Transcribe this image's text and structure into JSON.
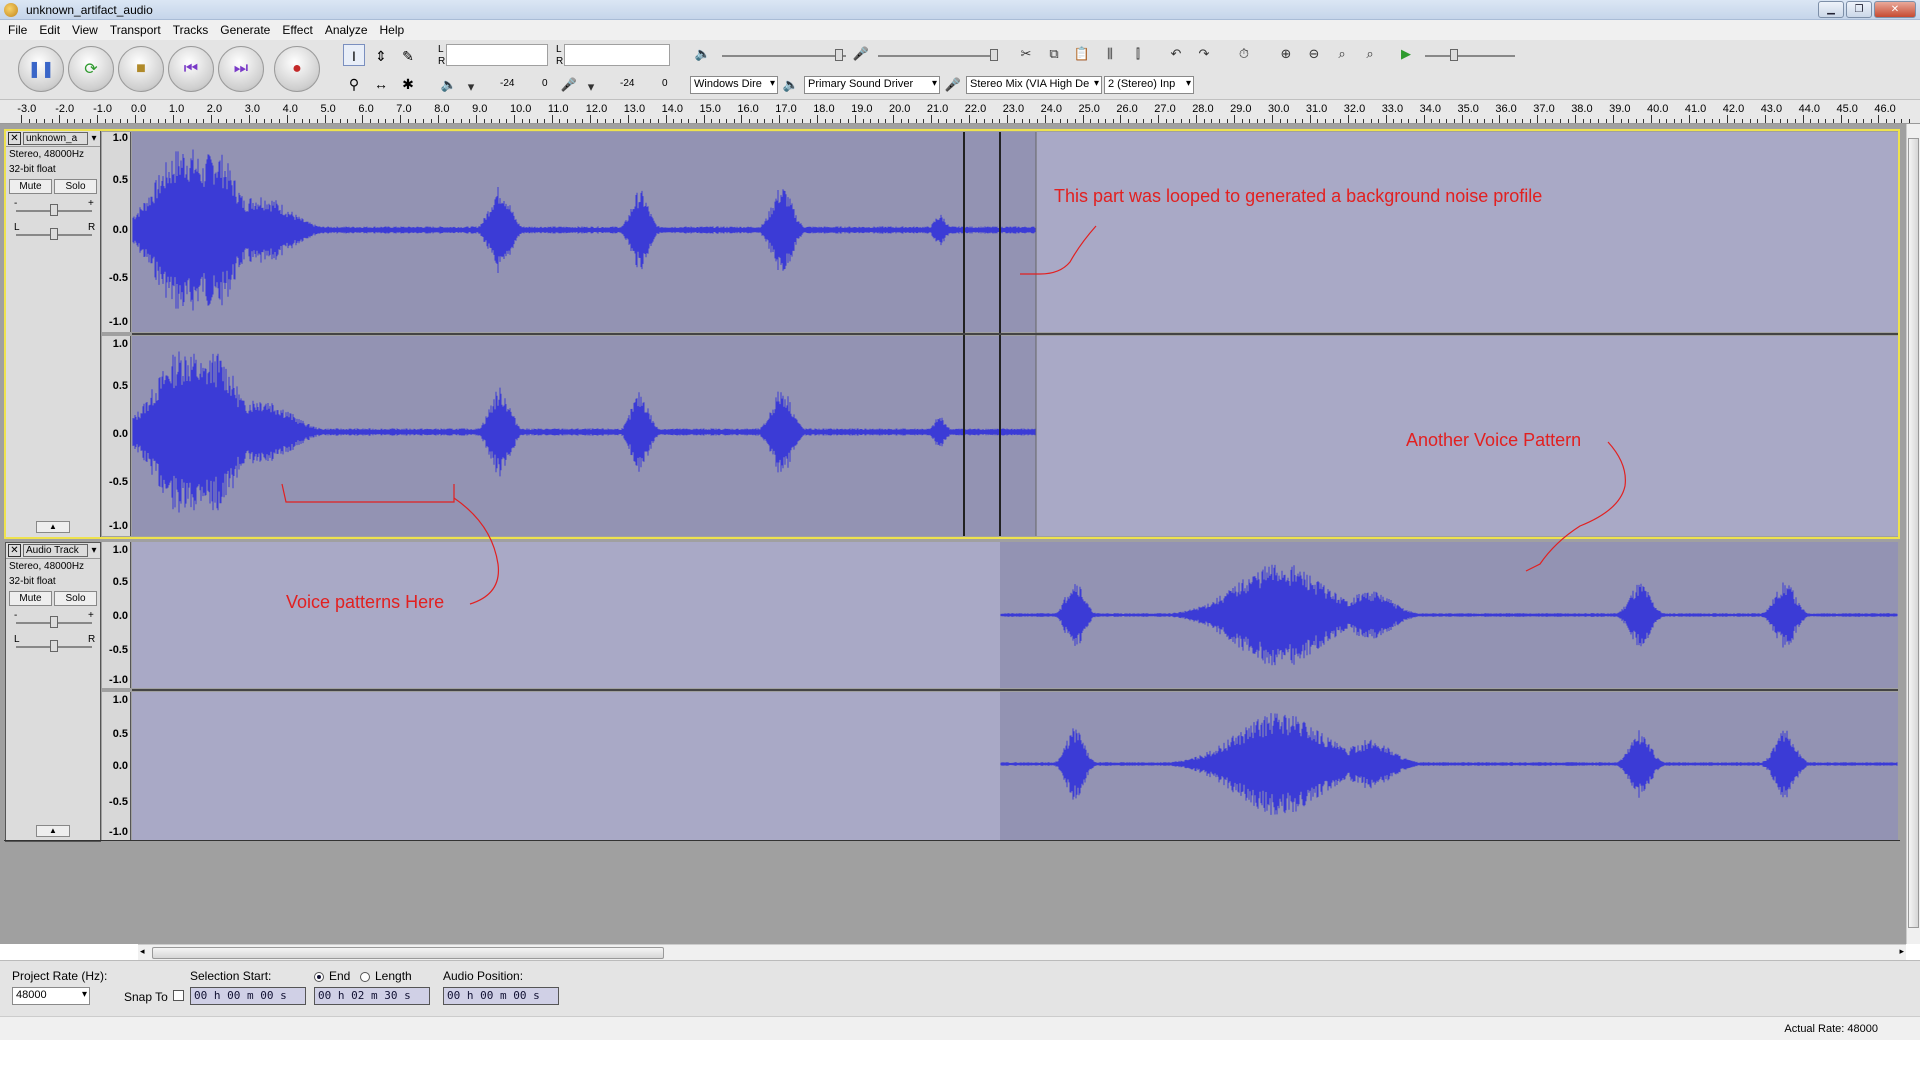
{
  "window": {
    "title": "unknown_artifact_audio"
  },
  "menu": [
    "File",
    "Edit",
    "View",
    "Transport",
    "Tracks",
    "Generate",
    "Effect",
    "Analyze",
    "Help"
  ],
  "meters": {
    "play_L": "L",
    "play_R": "R",
    "rec_L": "L",
    "rec_R": "R",
    "db_left": "-24",
    "db_zero": "0",
    "db_right": "-24",
    "db_zero2": "0"
  },
  "device": {
    "host": "Windows Dire",
    "output": "Primary Sound Driver",
    "input": "Stereo Mix (VIA High De",
    "channels": "2 (Stereo) Inp"
  },
  "ruler": {
    "labels": [
      "-3.0",
      "-2.0",
      "-1.0",
      "0.0",
      "1.0",
      "2.0",
      "3.0",
      "4.0",
      "5.0",
      "6.0",
      "7.0",
      "8.0",
      "9.0",
      "10.0",
      "11.0",
      "12.0",
      "13.0",
      "14.0",
      "15.0",
      "16.0",
      "17.0",
      "18.0",
      "19.0",
      "20.0",
      "21.0",
      "22.0",
      "23.0",
      "24.0",
      "25.0",
      "26.0",
      "27.0",
      "28.0",
      "29.0",
      "30.0",
      "31.0",
      "32.0",
      "33.0",
      "34.0",
      "35.0",
      "36.0",
      "37.0",
      "38.0",
      "39.0",
      "40.0",
      "41.0",
      "42.0",
      "43.0",
      "44.0",
      "45.0",
      "46.0"
    ]
  },
  "tracks": [
    {
      "name": "unknown_a",
      "format": "Stereo, 48000Hz",
      "depth": "32-bit float",
      "mute": "Mute",
      "solo": "Solo",
      "pan_l": "L",
      "pan_r": "R",
      "gain_minus": "-",
      "gain_plus": "+"
    },
    {
      "name": "Audio Track",
      "format": "Stereo, 48000Hz",
      "depth": "32-bit float",
      "mute": "Mute",
      "solo": "Solo",
      "pan_l": "L",
      "pan_r": "R",
      "gain_minus": "-",
      "gain_plus": "+"
    }
  ],
  "vscale": [
    "1.0",
    "0.5",
    "0.0",
    "-0.5",
    "-1.0"
  ],
  "annotations": {
    "noise": "This part was looped to generated a background noise profile",
    "voice": "Voice patterns Here",
    "another": "Another Voice Pattern"
  },
  "selection_bar": {
    "rate_label": "Project Rate (Hz):",
    "rate_value": "48000",
    "snap_label": "Snap To",
    "start_label": "Selection Start:",
    "end_label": "End",
    "length_label": "Length",
    "position_label": "Audio Position:",
    "start_value": "00 h 00 m 00 s",
    "end_value": "00 h 02 m 30 s",
    "position_value": "00 h 00 m 00 s"
  },
  "status": {
    "actual_rate": "Actual Rate: 48000"
  },
  "colors": {
    "waveform": "#3b3bd6",
    "track_bg": "#a9a9c6",
    "clip_bg": "#9393b3",
    "annotation": "#e22020",
    "selected_border": "#eee24e"
  }
}
